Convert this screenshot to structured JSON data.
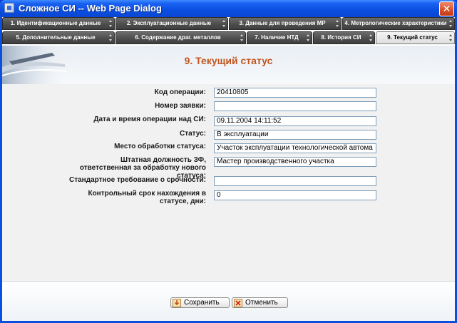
{
  "window": {
    "title": "Сложное СИ -- Web Page Dialog",
    "close_glyph": "✕"
  },
  "tabs_row1": [
    {
      "label": "1. Идентификационные данные"
    },
    {
      "label": "2. Эксплуатационные данные"
    },
    {
      "label": "3. Данные для проведения МР"
    },
    {
      "label": "4. Метрологические характеристики"
    }
  ],
  "tabs_row2": [
    {
      "label": "5. Дополнительные данные"
    },
    {
      "label": "6. Содержание драг. металлов"
    },
    {
      "label": "7. Наличие НТД"
    },
    {
      "label": "8. История СИ"
    },
    {
      "label": "9. Текущий статус"
    }
  ],
  "header": {
    "title": "9. Текущий статус"
  },
  "form": {
    "rows": [
      {
        "label": "Код операции:",
        "value": "20410805"
      },
      {
        "label": "Номер заявки:",
        "value": ""
      },
      {
        "label": "Дата и время операции над СИ:",
        "value": "09.11.2004 14:11:52"
      },
      {
        "label": "Статус:",
        "value": "В эксплуатации"
      },
      {
        "label": "Место обработки статуса:",
        "value": "Участок эксплуатации технологической автома"
      },
      {
        "label": "Штатная должность ЗФ, ответственная за обработку нового статуса:",
        "value": "Мастер производственного участка"
      },
      {
        "label": "Стандартное требование о срочности:",
        "value": ""
      },
      {
        "label": "Контрольный срок нахождения в статусе, дни:",
        "value": "0"
      }
    ]
  },
  "buttons": {
    "save": "Сохранить",
    "cancel": "Отменить"
  },
  "colors": {
    "title_orange": "#c0541c",
    "tab_dark": "#4e4e4e",
    "xp_blue": "#0a4ee0"
  },
  "icons": {
    "save": "save-icon",
    "cancel": "cancel-icon"
  }
}
